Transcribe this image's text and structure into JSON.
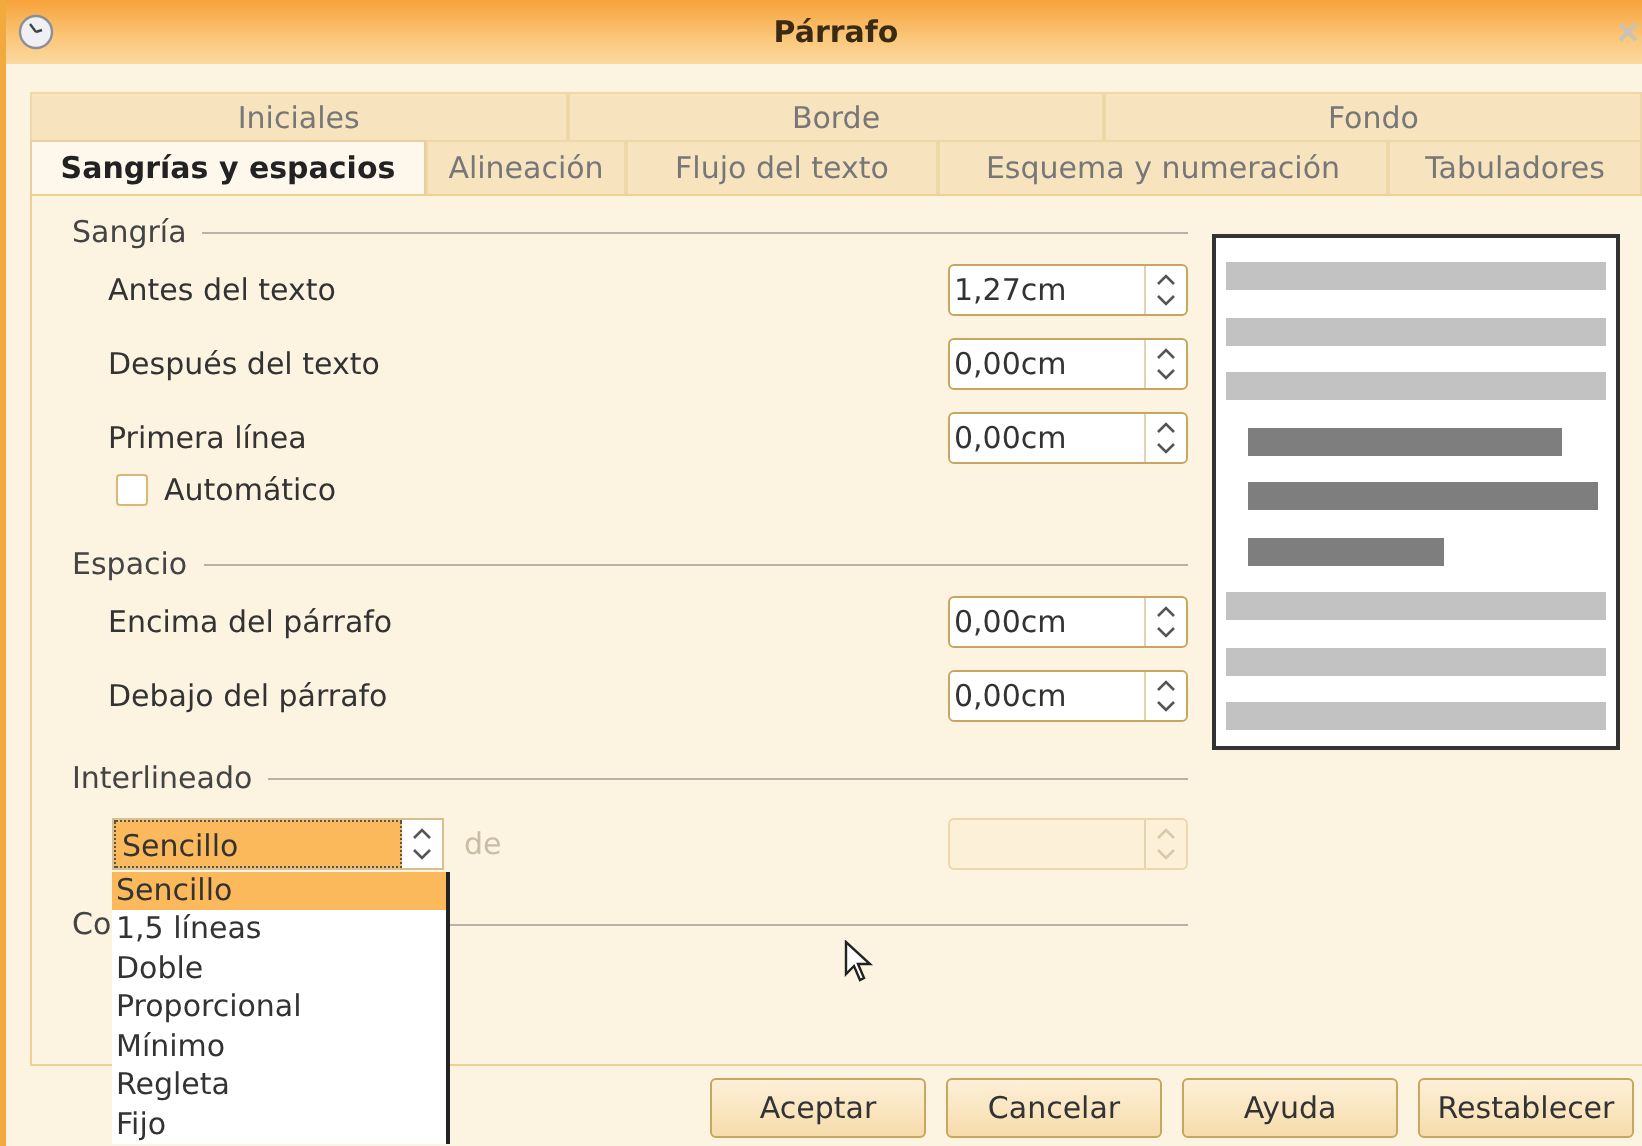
{
  "window": {
    "title": "Párrafo"
  },
  "tab_rows": [
    {
      "tabs": [
        {
          "label": "Iniciales",
          "selected": false
        },
        {
          "label": "Borde",
          "selected": false
        },
        {
          "label": "Fondo",
          "selected": false
        }
      ]
    },
    {
      "tabs": [
        {
          "label": "Sangrías y espacios",
          "selected": true
        },
        {
          "label": "Alineación",
          "selected": false
        },
        {
          "label": "Flujo del texto",
          "selected": false
        },
        {
          "label": "Esquema y numeración",
          "selected": false
        },
        {
          "label": "Tabuladores",
          "selected": false
        }
      ]
    }
  ],
  "sections": [
    {
      "heading": "Sangría",
      "rows": [
        {
          "kind": "spin",
          "label": "Antes del texto",
          "value": "1,27cm"
        },
        {
          "kind": "spin",
          "label": "Después del texto",
          "value": "0,00cm"
        },
        {
          "kind": "spin",
          "label": "Primera línea",
          "value": "0,00cm"
        },
        {
          "kind": "checkbox",
          "label": "Automático",
          "checked": false
        }
      ]
    },
    {
      "heading": "Espacio",
      "rows": [
        {
          "kind": "spin",
          "label": "Encima del párrafo",
          "value": "0,00cm"
        },
        {
          "kind": "spin",
          "label": "Debajo del párrafo",
          "value": "0,00cm"
        }
      ]
    },
    {
      "heading": "Interlineado",
      "rows": [
        {
          "kind": "select",
          "value": "Sencillo",
          "label": "de",
          "disabled": true
        }
      ]
    },
    {
      "heading": "Co"
    }
  ],
  "dropdown": {
    "options": [
      {
        "label": "Sencillo",
        "selected": true
      },
      {
        "label": "1,5 líneas",
        "selected": false
      },
      {
        "label": "Doble",
        "selected": false
      },
      {
        "label": "Proporcional",
        "selected": false
      },
      {
        "label": "Mínimo",
        "selected": false
      },
      {
        "label": "Regleta",
        "selected": false
      },
      {
        "label": "Fijo",
        "selected": false
      }
    ]
  },
  "buttons": [
    "Aceptar",
    "Cancelar",
    "Ayuda",
    "Restablecer"
  ]
}
